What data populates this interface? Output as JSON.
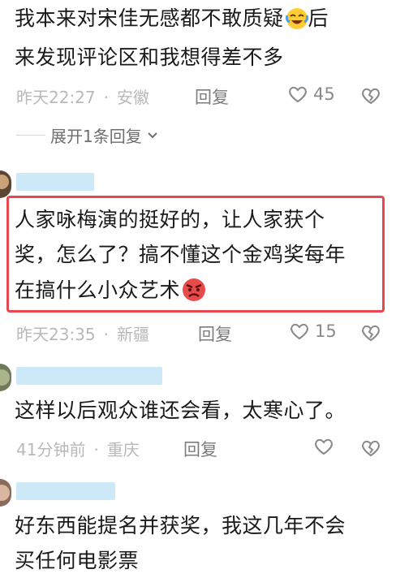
{
  "comments": [
    {
      "lines": [
        "我本来对宋佳无感都不敢质疑",
        "来发现评论区和我想得差不多"
      ],
      "line1_suffix": "后",
      "emoji": "laughing-crying-emoji",
      "time": "昨天22:27",
      "region": "安徽",
      "reply": "回复",
      "likes": "45",
      "expand": "展开1条回复"
    },
    {
      "lines": [
        "人家咏梅演的挺好的，让人家获个",
        "奖，怎么了？搞不懂这个金鸡奖每年",
        "在搞什么小众艺术"
      ],
      "emoji": "angry-face-emoji",
      "time": "昨天23:35",
      "region": "新疆",
      "reply": "回复",
      "likes": "15",
      "highlight_color": "#e8474f"
    },
    {
      "lines": [
        "这样以后观众谁还会看，太寒心了。"
      ],
      "time": "41分钟前",
      "region": "重庆",
      "reply": "回复",
      "likes": ""
    },
    {
      "lines": [
        "好东西能提名并获奖，我这几年不会",
        "买任何电影票"
      ]
    }
  ],
  "meta_separator": "·",
  "colors": {
    "highlight": "#e8474f",
    "name_bar": "#cde8f7",
    "meta": "#b9b9b9"
  }
}
